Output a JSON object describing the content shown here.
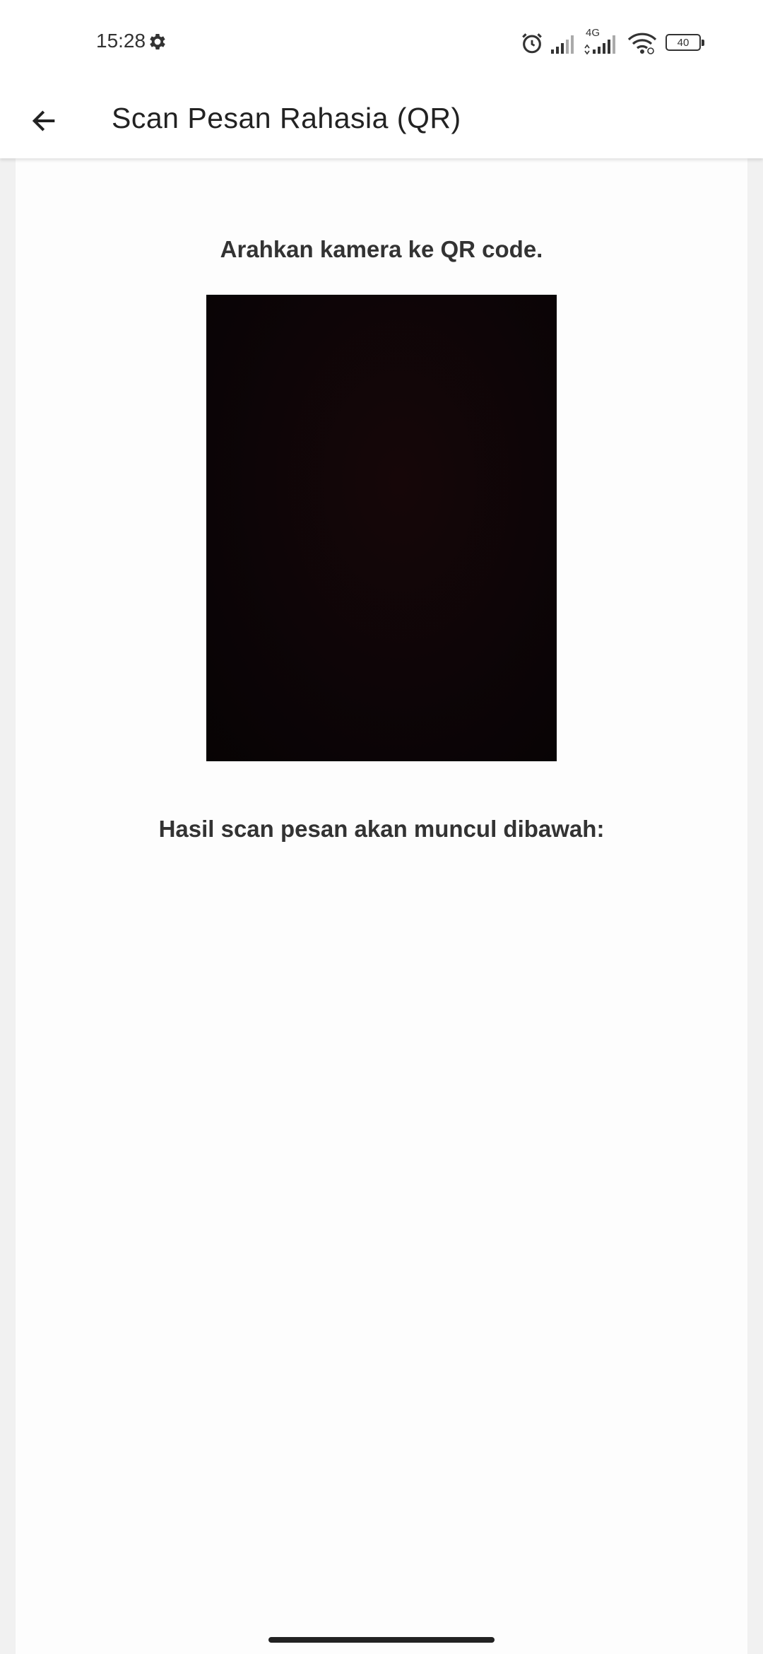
{
  "status_bar": {
    "time": "15:28",
    "network_type": "4G",
    "battery_level": "40",
    "icons": [
      "gear-icon",
      "alarm-icon",
      "signal-icon",
      "signal-4g-icon",
      "wifi-icon",
      "battery-icon"
    ]
  },
  "app_bar": {
    "back_icon": "arrow-left-icon",
    "title": "Scan Pesan Rahasia (QR)"
  },
  "scanner": {
    "instruction": "Arahkan kamera ke QR code.",
    "result_label": "Hasil scan pesan akan muncul dibawah:",
    "result_text": ""
  },
  "colors": {
    "app_bar_background": "#ffffff",
    "page_background": "#f1f1f1",
    "card_background": "#fdfdfd",
    "text_primary": "#333333",
    "camera_preview": "#0d0507"
  }
}
